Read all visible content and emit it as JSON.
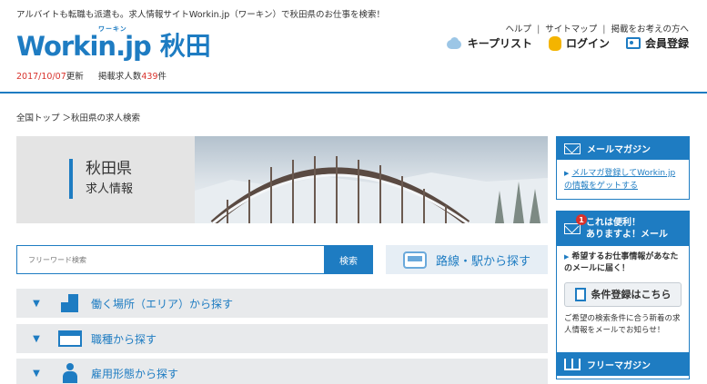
{
  "header": {
    "tagline": "アルバイトも転職も派遣も。求人情報サイトWorkin.jp（ワーキン）で秋田県のお仕事を検索！",
    "logo": {
      "word": "Workin",
      "dot_jp": ".jp",
      "kana": "ワーキン",
      "prefecture": "秋田"
    },
    "update_date": "2017/10/07",
    "update_suffix": "更新",
    "listing_label": "掲載求人数",
    "listing_count": "439",
    "listing_unit": "件",
    "util_links": [
      "ヘルプ",
      "サイトマップ",
      "掲載をお考えの方へ"
    ],
    "actions": {
      "keep_list": "キープリスト",
      "login": "ログイン",
      "register": "会員登録"
    },
    "accent_color": "#1e7cc2",
    "highlight_color": "#d8322c"
  },
  "breadcrumb": {
    "text": "全国トップ ＞秋田県の求人検索"
  },
  "hero": {
    "title": "秋田県",
    "subtitle": "求人情報",
    "photo_icon": "snowy-arch-bridge-photo"
  },
  "search": {
    "placeholder": "フリーワード検索",
    "button": "検索",
    "route_button": "路線・駅から探す",
    "route_icon": "train-icon"
  },
  "accordion": [
    {
      "label": "働く場所（エリア）から探す",
      "icon": "buildings-icon"
    },
    {
      "label": "職種から探す",
      "icon": "shop-icon"
    },
    {
      "label": "雇用形態から探す",
      "icon": "person-icon"
    }
  ],
  "sidebar": {
    "mail_magazine": {
      "title": "メールマガジン",
      "link_text": "メルマガ登録してWorkin.jpの情報をゲットする"
    },
    "alert_mail": {
      "badge": "1",
      "title_line1": "これは便利！",
      "title_line2": "ありますよ！メール",
      "lead": "希望するお仕事情報があなたのメールに届く！",
      "button": "条件登録はこちら",
      "note": "ご希望の検索条件に合う新着の求人情報をメールでお知らせ！"
    },
    "free_magazine": {
      "title": "フリーマガジン"
    }
  }
}
